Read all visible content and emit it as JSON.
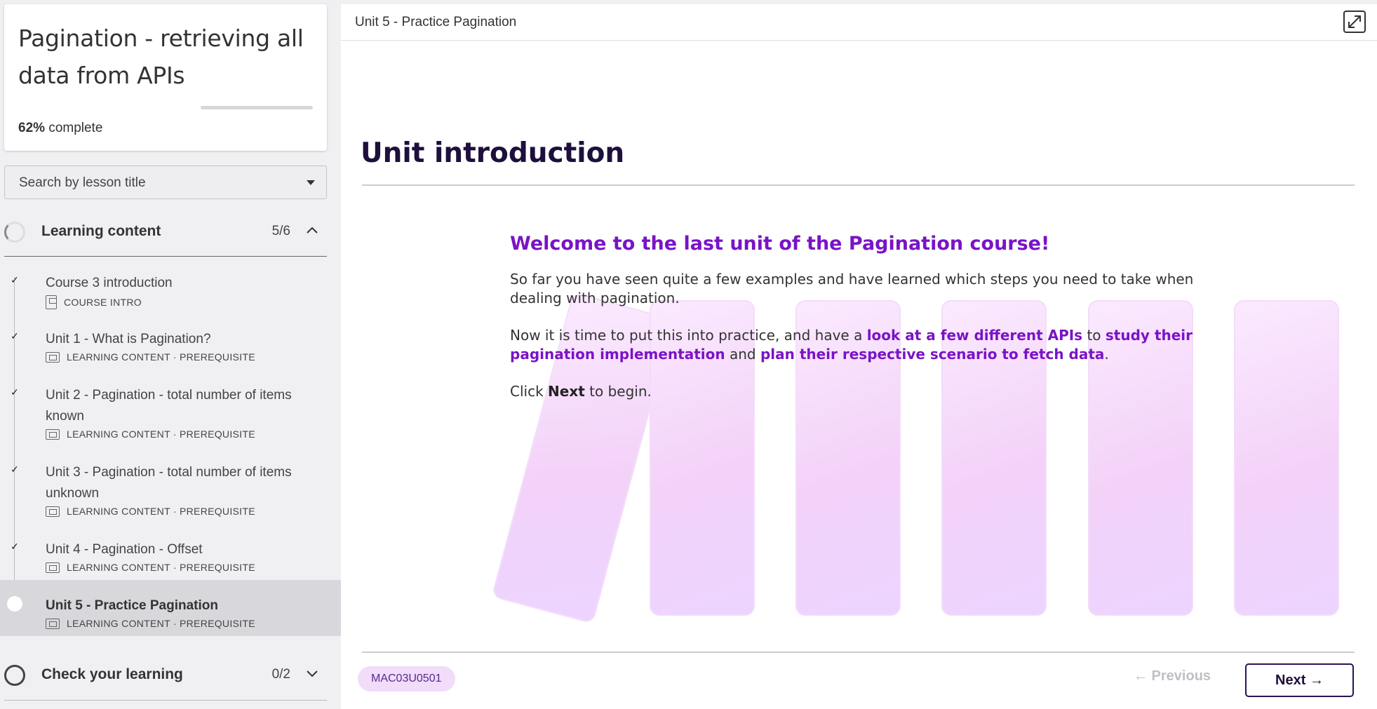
{
  "course": {
    "title": "Pagination - retrieving all data from APIs",
    "progress_percent": "62%",
    "progress_suffix": "complete",
    "progress_fraction": 0.0
  },
  "search": {
    "placeholder": "Search by lesson title"
  },
  "sections": [
    {
      "label": "Learning content",
      "count": "5/6",
      "chevron": "^",
      "expanded": true
    },
    {
      "label": "Check your learning",
      "count": "0/2",
      "chevron": "v",
      "expanded": false
    }
  ],
  "lessons": [
    {
      "title": "Course 3 introduction",
      "meta": "COURSE INTRO",
      "icon": "document-icon",
      "done": true
    },
    {
      "title": "Unit 1 - What is Pagination?",
      "meta": "LEARNING CONTENT · PREREQUISITE",
      "icon": "slides-icon",
      "done": true
    },
    {
      "title": "Unit 2 - Pagination - total number of items known",
      "meta": "LEARNING CONTENT · PREREQUISITE",
      "icon": "slides-icon",
      "done": true
    },
    {
      "title": "Unit 3 - Pagination - total number of items unknown",
      "meta": "LEARNING CONTENT · PREREQUISITE",
      "icon": "slides-icon",
      "done": true
    },
    {
      "title": "Unit 4 - Pagination - Offset",
      "meta": "LEARNING CONTENT · PREREQUISITE",
      "icon": "slides-icon",
      "done": true
    },
    {
      "title": "Unit 5 - Practice Pagination",
      "meta": "LEARNING CONTENT · PREREQUISITE",
      "icon": "slides-icon",
      "done": false,
      "active": true
    }
  ],
  "main": {
    "unit_label": "Unit 5 - Practice Pagination",
    "heading": "Unit introduction",
    "welcome": "Welcome to the last unit of the Pagination course!",
    "para1": "So far you have seen quite a few examples and have learned which steps you need to take when dealing with pagination.",
    "para2_a": "Now it is time to put this into practice, and have a ",
    "para2_h1": "look at a few different APIs",
    "para2_b": " to ",
    "para2_h2": "study their pagination implementation",
    "para2_c": " and ",
    "para2_h3": "plan their respective scenario to fetch data",
    "para2_d": ".",
    "para3_a": "Click ",
    "para3_b": "Next",
    "para3_c": " to begin.",
    "code": "MAC03U0501",
    "prev_label": "← Previous",
    "next_label": "Next →"
  },
  "colors": {
    "accent": "#7a13c6",
    "heading": "#1e0f3c",
    "badge_bg": "#f1dcfa"
  }
}
